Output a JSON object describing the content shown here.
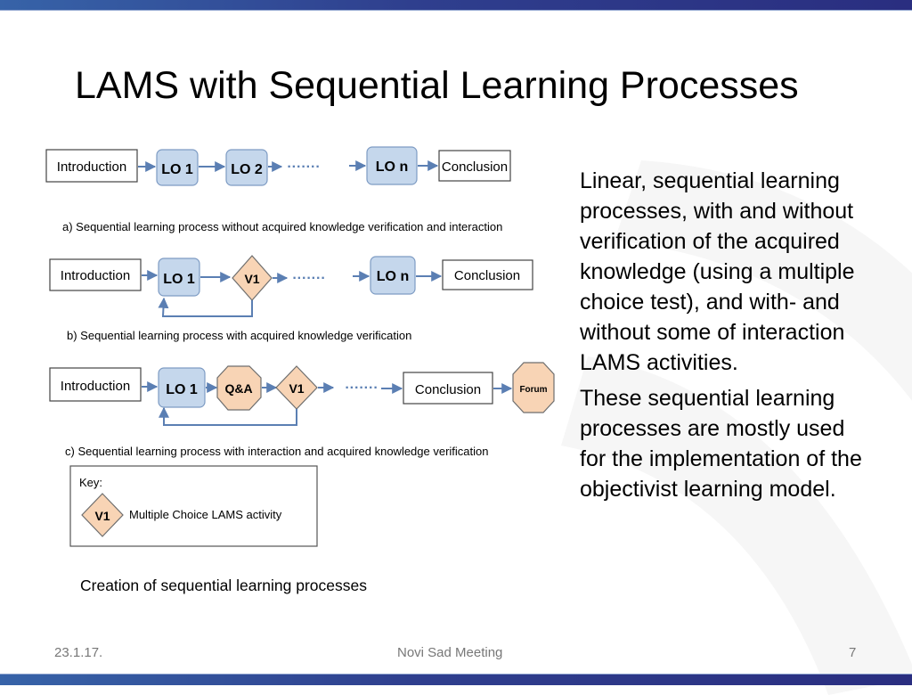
{
  "slide": {
    "title": "LAMS with Sequential Learning Processes",
    "figure_caption": "Creation of sequential learning processes",
    "body_paragraphs": [
      "Linear, sequential learning processes, with and without verification of the acquired knowledge (using a multiple choice test), and with- and without some of interaction LAMS activities.",
      "These sequential learning processes are mostly used for the implementation of the objectivist learning model."
    ],
    "footer": {
      "date": "23.1.17.",
      "center": "Novi Sad Meeting",
      "page_number": "7"
    }
  },
  "diagram": {
    "colors": {
      "lo_fill": "#c5d7ec",
      "lo_stroke": "#7d9bc3",
      "activity_fill": "#f8d4b5",
      "activity_stroke": "#6e6e6e",
      "arrow": "#5b7fb3",
      "banner": "#2e3b8c"
    },
    "process_a": {
      "caption": "a) Sequential learning process without acquired knowledge verification and interaction",
      "nodes": {
        "intro": "Introduction",
        "lo1": "LO 1",
        "lo2": "LO 2",
        "ellipsis": "·······",
        "lon": "LO n",
        "conclusion": "Conclusion"
      }
    },
    "process_b": {
      "caption": "b) Sequential learning process with acquired knowledge verification",
      "nodes": {
        "intro": "Introduction",
        "lo1": "LO 1",
        "v1": "V1",
        "ellipsis": "·······",
        "lon": "LO n",
        "conclusion": "Conclusion"
      }
    },
    "process_c": {
      "caption": "c) Sequential learning process with interaction and acquired knowledge verification",
      "nodes": {
        "intro": "Introduction",
        "lo1": "LO 1",
        "qa": "Q&A",
        "v1": "V1",
        "ellipsis": "·······",
        "conclusion": "Conclusion",
        "forum": "Forum"
      }
    },
    "key": {
      "title": "Key:",
      "symbol": "V1",
      "description": "Multiple Choice LAMS activity"
    }
  }
}
